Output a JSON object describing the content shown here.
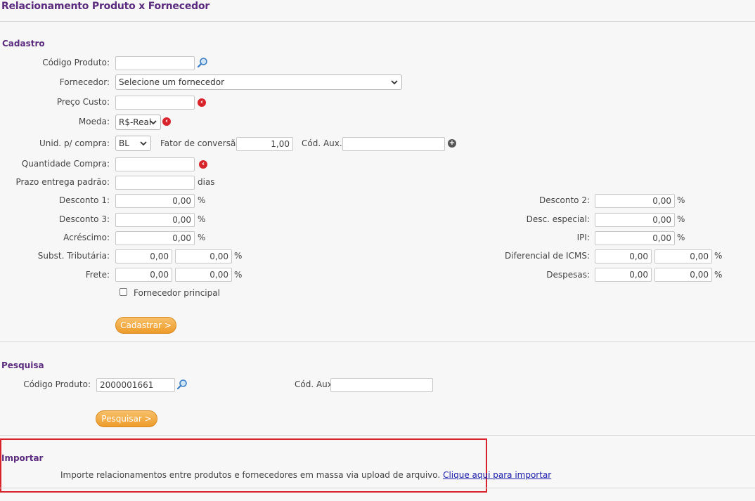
{
  "page": {
    "title": "Relacionamento Produto x Fornecedor"
  },
  "cadastro": {
    "title": "Cadastro",
    "codigo_produto_label": "Código Produto:",
    "codigo_produto_value": "",
    "fornecedor_label": "Fornecedor:",
    "fornecedor_selected": "Selecione um fornecedor",
    "preco_custo_label": "Preço Custo:",
    "preco_custo_value": "",
    "moeda_label": "Moeda:",
    "moeda_selected": "R$-Real",
    "unid_label": "Unid. p/ compra:",
    "unid_selected": "BL",
    "fator_label": "Fator de conversão:",
    "fator_value": "1,00",
    "cod_aux_label": "Cód. Aux.:",
    "cod_aux_value": "",
    "quantidade_label": "Quantidade Compra:",
    "quantidade_value": "",
    "prazo_label": "Prazo entrega padrão:",
    "prazo_value": "",
    "prazo_unit": "dias",
    "desconto1_label": "Desconto 1:",
    "desconto1_value": "0,00",
    "desconto2_label": "Desconto 2:",
    "desconto2_value": "0,00",
    "desconto3_label": "Desconto 3:",
    "desconto3_value": "0,00",
    "desc_especial_label": "Desc. especial:",
    "desc_especial_value": "0,00",
    "acrescimo_label": "Acréscimo:",
    "acrescimo_value": "0,00",
    "ipi_label": "IPI:",
    "ipi_value": "0,00",
    "subst_label": "Subst. Tributária:",
    "subst_value1": "0,00",
    "subst_value2": "0,00",
    "dif_icms_label": "Diferencial de ICMS:",
    "dif_icms_value1": "0,00",
    "dif_icms_value2": "0,00",
    "frete_label": "Frete:",
    "frete_value1": "0,00",
    "frete_value2": "0,00",
    "despesas_label": "Despesas:",
    "despesas_value1": "0,00",
    "despesas_value2": "0,00",
    "percent": "%",
    "fornecedor_principal_label": "Fornecedor principal",
    "cadastrar_button": "Cadastrar >"
  },
  "pesquisa": {
    "title": "Pesquisa",
    "codigo_produto_label": "Código Produto:",
    "codigo_produto_value": "2000001661",
    "cod_aux_label": "Cód. Aux.:",
    "cod_aux_value": "",
    "pesquisar_button": "Pesquisar >"
  },
  "importar": {
    "title": "Importar",
    "description": "Importe relacionamentos entre produtos e fornecedores em massa via upload de arquivo.",
    "link_text": "Clique aqui para importar"
  },
  "colors": {
    "accent": "#5b2c7e",
    "button": "#ee9c2a",
    "highlight": "#d8232a"
  }
}
